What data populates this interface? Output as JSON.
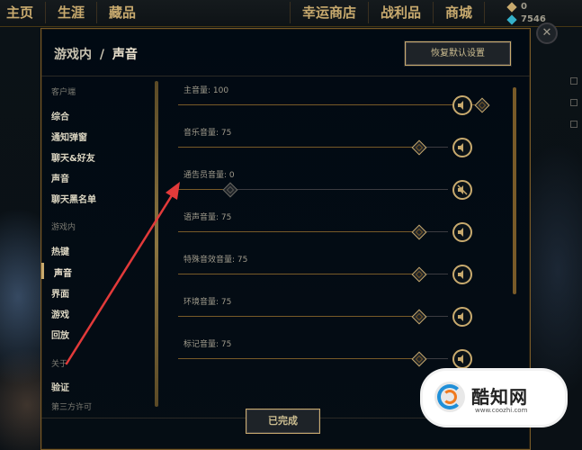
{
  "top_nav": {
    "left": [
      "主页",
      "生涯",
      "藏品"
    ],
    "right": [
      "幸运商店",
      "战利品",
      "商城"
    ]
  },
  "currency": {
    "orange_essence": "0",
    "blue_essence": "7546"
  },
  "close_glyph": "✕",
  "modal": {
    "breadcrumb_section": "游戏内",
    "breadcrumb_sep": "/",
    "breadcrumb_current": "声音",
    "reset_button": "恢复默认设置",
    "done_button": "已完成"
  },
  "sidebar": {
    "client_header": "客户端",
    "client_items": [
      "综合",
      "通知弹窗",
      "聊天&好友",
      "声音",
      "聊天黑名单"
    ],
    "ingame_header": "游戏内",
    "ingame_items": [
      "热键",
      "声音",
      "界面",
      "游戏",
      "回放"
    ],
    "about_header": "关于",
    "about_items": [
      "验证",
      "第三方许可"
    ],
    "active_item": "声音"
  },
  "sliders": [
    {
      "label": "主音量: 100",
      "value": 100,
      "muted": false
    },
    {
      "label": "音乐音量: 75",
      "value": 75,
      "muted": false
    },
    {
      "label": "通告员音量: 0",
      "value": 0,
      "muted": true
    },
    {
      "label": "语声音量: 75",
      "value": 75,
      "muted": false
    },
    {
      "label": "特殊音效音量: 75",
      "value": 75,
      "muted": false
    },
    {
      "label": "环境音量: 75",
      "value": 75,
      "muted": false
    },
    {
      "label": "标记音量: 75",
      "value": 75,
      "muted": false
    }
  ],
  "colors": {
    "gold": "#c8aa6e",
    "annotation_arrow": "#e23a3a",
    "blue_essence": "#35b1c9",
    "orange_essence": "#c8aa6e"
  },
  "watermark": {
    "name": "酷知网",
    "url": "www.coozhi.com"
  }
}
